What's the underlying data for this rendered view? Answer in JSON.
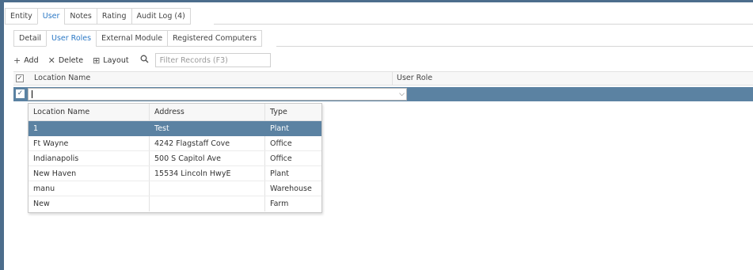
{
  "tabs_primary": [
    "Entity",
    "User",
    "Notes",
    "Rating",
    "Audit Log (4)"
  ],
  "tabs_secondary": [
    "Detail",
    "User Roles",
    "External Module",
    "Registered Computers"
  ],
  "toolbar": {
    "add_label": "Add",
    "delete_label": "Delete",
    "layout_label": "Layout",
    "filter_placeholder": "Filter Records (F3)"
  },
  "grid": {
    "columns": [
      "Location Name",
      "User Role"
    ]
  },
  "dropdown": {
    "columns": [
      "Location Name",
      "Address",
      "Type"
    ],
    "rows": [
      [
        "1",
        "Test",
        "Plant"
      ],
      [
        "Ft Wayne",
        "4242 Flagstaff Cove",
        "Office"
      ],
      [
        "Indianapolis",
        "500 S Capitol Ave",
        "Office"
      ],
      [
        "New Haven",
        "15534 Lincoln HwyE",
        "Plant"
      ],
      [
        "manu",
        "",
        "Warehouse"
      ],
      [
        "New",
        "",
        "Farm"
      ]
    ]
  },
  "colors": {
    "selection": "#5b82a2",
    "active_tab": "#2b78c5",
    "rail": "#4c6d8c"
  }
}
